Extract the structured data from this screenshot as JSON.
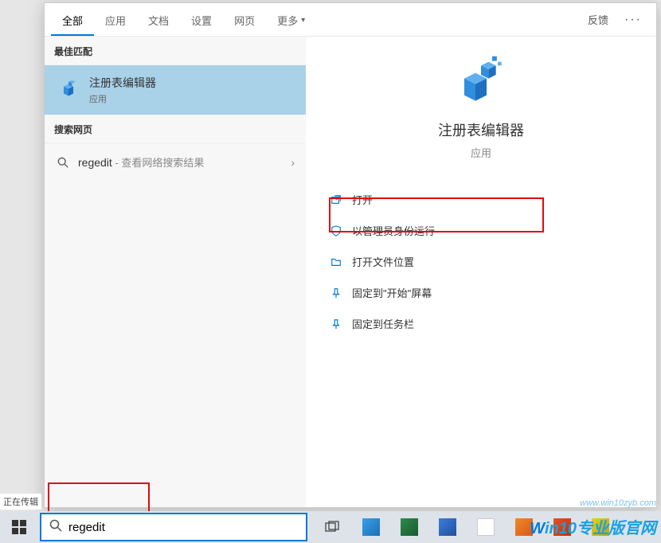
{
  "tabs": {
    "all": "全部",
    "apps": "应用",
    "docs": "文档",
    "settings": "设置",
    "web": "网页",
    "more": "更多"
  },
  "topright": {
    "feedback": "反馈",
    "more": "···"
  },
  "sections": {
    "best_match": "最佳匹配",
    "search_web": "搜索网页"
  },
  "best_match": {
    "title": "注册表编辑器",
    "subtitle": "应用"
  },
  "web_result": {
    "query": "regedit",
    "hint": " - 查看网络搜索结果"
  },
  "detail": {
    "title": "注册表编辑器",
    "subtitle": "应用"
  },
  "actions": {
    "open": "打开",
    "run_admin": "以管理员身份运行",
    "open_location": "打开文件位置",
    "pin_start": "固定到\"开始\"屏幕",
    "pin_taskbar": "固定到任务栏"
  },
  "status": "正在传辑",
  "search_input": {
    "value": "regedit"
  },
  "watermarks": {
    "url": "www.win10zyb.com",
    "brand_w": "W",
    "brand_rest": "in10专业版官网"
  }
}
